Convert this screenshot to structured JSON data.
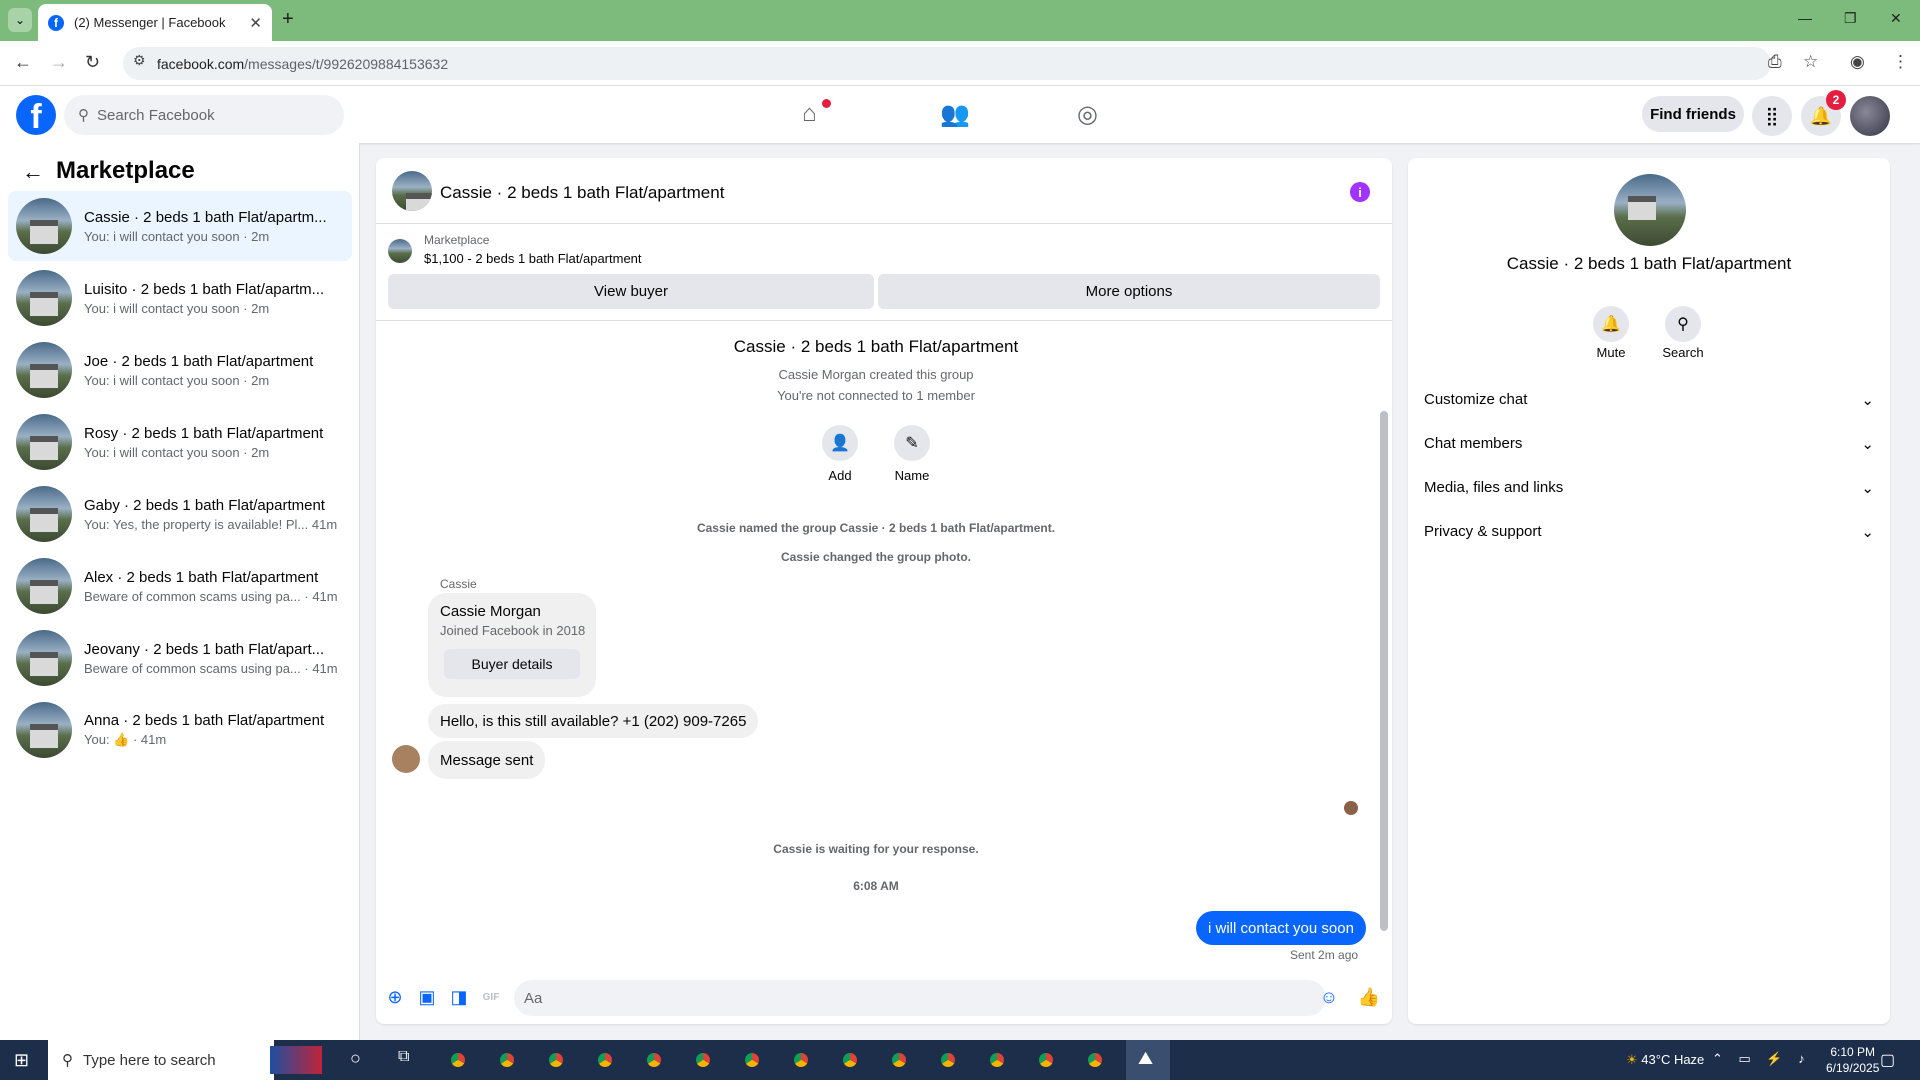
{
  "browser": {
    "tab_title": "(2) Messenger | Facebook",
    "url_host": "facebook.com",
    "url_path": "/messages/t/9926209884153632"
  },
  "fb": {
    "search_placeholder": "Search Facebook",
    "find_friends": "Find friends",
    "notif_count": "2"
  },
  "sidebar": {
    "title": "Marketplace",
    "conversations": [
      {
        "name": "Cassie · 2 beds 1 bath Flat/apartm...",
        "preview": "You: i will contact you soon · 2m"
      },
      {
        "name": "Luisito · 2 beds 1 bath Flat/apartm...",
        "preview": "You: i will contact you soon · 2m"
      },
      {
        "name": "Joe · 2 beds 1 bath Flat/apartment",
        "preview": "You: i will contact you soon · 2m"
      },
      {
        "name": "Rosy · 2 beds 1 bath Flat/apartment",
        "preview": "You: i will contact you soon · 2m"
      },
      {
        "name": "Gaby · 2 beds 1 bath Flat/apartment",
        "preview": "You: Yes, the property is available! Pl... 41m"
      },
      {
        "name": "Alex · 2 beds 1 bath Flat/apartment",
        "preview": "Beware of common scams using pa... · 41m"
      },
      {
        "name": "Jeovany · 2 beds 1 bath Flat/apart...",
        "preview": "Beware of common scams using pa... · 41m"
      },
      {
        "name": "Anna · 2 beds 1 bath Flat/apartment",
        "preview": "You: 👍 · 41m"
      }
    ]
  },
  "chat": {
    "title": "Cassie · 2 beds 1 bath Flat/apartment",
    "listing_label": "Marketplace",
    "listing_desc": "$1,100 - 2 beds 1 bath Flat/apartment",
    "view_buyer": "View buyer",
    "more_options": "More options",
    "group_title": "Cassie · 2 beds 1 bath Flat/apartment",
    "created": "Cassie Morgan created this group",
    "not_connected": "You're not connected to 1 member",
    "add_label": "Add",
    "name_label": "Name",
    "sys1": "Cassie named the group Cassie · 2 beds 1 bath Flat/apartment.",
    "sys2": "Cassie changed the group photo.",
    "sender": "Cassie",
    "card_name": "Cassie Morgan",
    "card_sub": "Joined Facebook in 2018",
    "buyer_details": "Buyer details",
    "msg1": "Hello, is this still available? +1 (202) 909-7265",
    "msg2": "Message sent",
    "waiting": "Cassie is waiting for your response.",
    "time": "6:08 AM",
    "my_msg": "i will contact you soon",
    "sent": "Sent 2m ago",
    "composer_placeholder": "Aa"
  },
  "right": {
    "title": "Cassie · 2 beds 1 bath Flat/apartment",
    "mute": "Mute",
    "search": "Search",
    "sections": [
      "Customize chat",
      "Chat members",
      "Media, files and links",
      "Privacy & support"
    ]
  },
  "taskbar": {
    "search_placeholder": "Type here to search",
    "weather": "43°C  Haze",
    "time": "6:10 PM",
    "date": "6/19/2025"
  }
}
